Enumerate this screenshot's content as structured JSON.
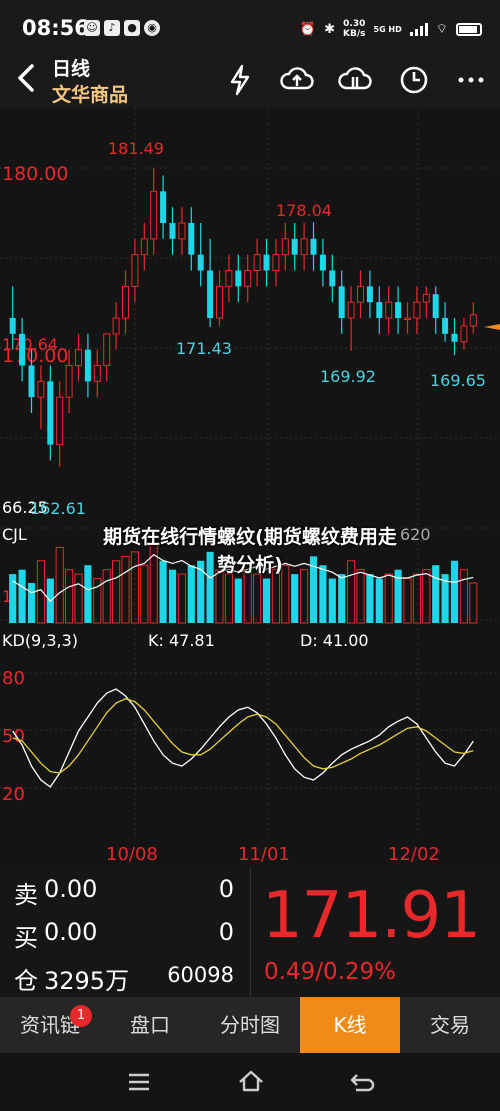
{
  "status_bar": {
    "time": "08:56",
    "net_speed_value": "0.30",
    "net_speed_unit": "KB/s",
    "network": "5G HD"
  },
  "header": {
    "title": "日线",
    "subtitle": "文华商品",
    "icons": [
      "flash-icon",
      "cloud-upload-icon",
      "cloud-alarm-icon",
      "clock-icon",
      "more-icon"
    ]
  },
  "chart": {
    "y_labels": [
      "180.00",
      "170.64",
      "170.00",
      "66.25"
    ],
    "annotations": {
      "high1": "181.49",
      "high2": "178.04",
      "low1": "171.43",
      "low2": "169.92",
      "low3": "169.65",
      "min": "162.61"
    },
    "volume_label": "CJL",
    "volume_value_partial": "620",
    "volume_left_partial": "1.07",
    "kd_label": "KD(9,3,3)",
    "kd_k": "K: 47.81",
    "kd_d": "D: 41.00",
    "kd_levels": [
      "80",
      "50",
      "20"
    ],
    "x_labels": [
      "10/08",
      "11/01",
      "12/02"
    ]
  },
  "article_title_line1": "期货在线行情螺纹(期货螺纹费用走",
  "article_title_line2": "势分析)",
  "quote": {
    "sell_label": "卖",
    "sell_price": "0.00",
    "sell_qty": "0",
    "buy_label": "买",
    "buy_price": "0.00",
    "buy_qty": "0",
    "oi_label": "仓",
    "oi_value": "3295万",
    "oi_num": "60098",
    "last_price": "171.91",
    "change": "0.49/0.29%",
    "colors": {
      "up": "#e8292b",
      "accent": "#f08a18"
    }
  },
  "tabs": [
    {
      "label": "资讯链",
      "badge": "1"
    },
    {
      "label": "盘口"
    },
    {
      "label": "分时图"
    },
    {
      "label": "K线"
    },
    {
      "label": "交易"
    }
  ],
  "chart_data": {
    "type": "candlestick",
    "candles": [
      [
        172,
        174,
        170,
        171
      ],
      [
        171,
        172,
        168,
        169
      ],
      [
        169,
        170,
        166,
        167
      ],
      [
        167,
        169,
        165,
        168
      ],
      [
        168,
        169,
        163,
        164
      ],
      [
        164,
        168,
        162.61,
        167
      ],
      [
        167,
        170,
        166,
        169
      ],
      [
        169,
        171,
        168,
        170
      ],
      [
        170,
        171,
        167,
        168
      ],
      [
        168,
        170,
        167,
        169
      ],
      [
        169,
        171,
        168,
        171
      ],
      [
        171,
        173,
        170,
        172
      ],
      [
        172,
        175,
        171,
        174
      ],
      [
        174,
        177,
        173,
        176
      ],
      [
        176,
        178,
        175,
        177
      ],
      [
        177,
        181.49,
        176,
        180
      ],
      [
        180,
        181,
        177,
        178
      ],
      [
        178,
        179,
        176,
        177
      ],
      [
        177,
        179,
        176,
        178
      ],
      [
        178,
        179,
        175,
        176
      ],
      [
        176,
        178,
        174,
        175
      ],
      [
        175,
        177,
        171.43,
        172
      ],
      [
        172,
        175,
        171.5,
        174
      ],
      [
        174,
        176,
        173,
        175
      ],
      [
        175,
        176,
        173,
        174
      ],
      [
        174,
        176,
        173,
        175
      ],
      [
        175,
        177,
        174,
        176
      ],
      [
        176,
        177,
        174,
        175
      ],
      [
        175,
        177,
        174,
        176
      ],
      [
        176,
        178,
        175,
        177
      ],
      [
        177,
        178,
        175,
        176
      ],
      [
        176,
        178,
        175,
        177
      ],
      [
        177,
        178.04,
        175,
        176
      ],
      [
        176,
        177,
        174,
        175
      ],
      [
        175,
        176,
        173,
        174
      ],
      [
        174,
        175,
        171,
        172
      ],
      [
        172,
        174,
        169.92,
        173
      ],
      [
        173,
        175,
        172,
        174
      ],
      [
        174,
        175,
        172,
        173
      ],
      [
        173,
        174,
        171,
        172
      ],
      [
        172,
        174,
        171,
        173
      ],
      [
        173,
        174,
        171,
        172
      ],
      [
        172,
        173,
        171,
        172
      ],
      [
        172,
        174,
        171,
        173
      ],
      [
        173,
        174,
        172,
        173.5
      ],
      [
        173.5,
        174,
        171,
        172
      ],
      [
        172,
        173,
        170.5,
        171
      ],
      [
        171,
        172,
        169.65,
        170.5
      ],
      [
        170.5,
        172,
        170,
        171.5
      ],
      [
        171.5,
        173,
        171,
        172.2
      ]
    ],
    "volume": [
      55,
      60,
      45,
      70,
      50,
      85,
      60,
      55,
      65,
      50,
      60,
      70,
      75,
      80,
      65,
      90,
      70,
      60,
      55,
      65,
      70,
      80,
      60,
      55,
      50,
      60,
      55,
      50,
      60,
      65,
      55,
      60,
      75,
      65,
      50,
      55,
      70,
      60,
      55,
      50,
      55,
      60,
      50,
      55,
      60,
      65,
      55,
      70,
      60,
      45
    ],
    "k": [
      55,
      45,
      30,
      20,
      15,
      25,
      40,
      55,
      65,
      75,
      82,
      85,
      80,
      72,
      60,
      48,
      38,
      32,
      30,
      35,
      42,
      50,
      58,
      65,
      70,
      72,
      68,
      60,
      50,
      38,
      28,
      22,
      20,
      25,
      32,
      38,
      42,
      45,
      48,
      52,
      58,
      62,
      65,
      60,
      50,
      40,
      32,
      30,
      38,
      47.81
    ],
    "d": [
      50,
      48,
      40,
      32,
      26,
      25,
      30,
      38,
      48,
      58,
      68,
      75,
      78,
      76,
      70,
      62,
      54,
      46,
      40,
      38,
      38,
      42,
      48,
      54,
      60,
      65,
      67,
      65,
      60,
      52,
      44,
      36,
      30,
      28,
      29,
      32,
      35,
      39,
      42,
      45,
      49,
      53,
      57,
      58,
      55,
      50,
      45,
      40,
      39,
      41.0
    ],
    "ylim": [
      160,
      184
    ],
    "x_ticks": [
      "10/08",
      "11/01",
      "12/02"
    ]
  }
}
